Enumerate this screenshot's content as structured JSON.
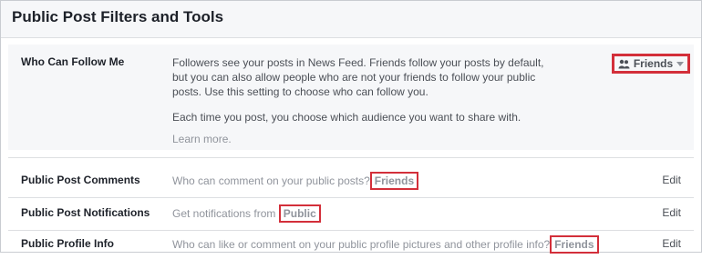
{
  "header": {
    "title": "Public Post Filters and Tools"
  },
  "follow": {
    "label": "Who Can Follow Me",
    "line1": "Followers see your posts in News Feed. Friends follow your posts by default,",
    "line2": "but you can also allow people who are not your friends to follow your public",
    "line3": "posts. Use this setting to choose who can follow you.",
    "line4": "Each time you post, you choose which audience you want to share with.",
    "learn_more": "Learn more.",
    "audience_label": "Friends",
    "audience_icon": "friends-icon",
    "dropdown_icon": "caret-down-icon"
  },
  "rows": [
    {
      "label": "Public Post Comments",
      "text": "Who can comment on your public posts?",
      "value": "Friends",
      "edit": "Edit"
    },
    {
      "label": "Public Post Notifications",
      "text": "Get notifications from",
      "value": "Public",
      "edit": "Edit"
    },
    {
      "label": "Public Profile Info",
      "text": "Who can like or comment on your public profile pictures and other profile info?",
      "value": "Friends",
      "edit": "Edit"
    }
  ],
  "colors": {
    "highlight": "#d32f3a",
    "panel": "#f6f7f9",
    "border": "#dddfe2"
  }
}
